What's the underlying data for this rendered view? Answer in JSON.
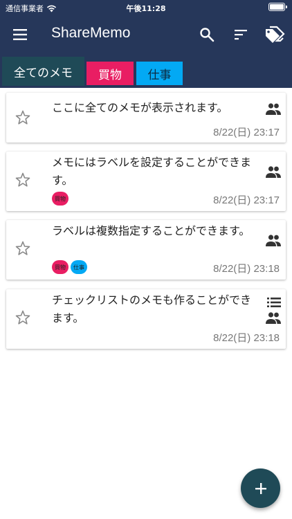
{
  "status_bar": {
    "carrier": "通信事業者",
    "time": "午後11:28"
  },
  "appbar": {
    "title": "ShareMemo",
    "icons": [
      "menu-icon",
      "search-icon",
      "sort-icon",
      "label-icon"
    ]
  },
  "tabs": [
    {
      "label": "全てのメモ",
      "color": "#1f4a57",
      "selected": true
    },
    {
      "label": "買物",
      "color": "#e91e63",
      "selected": false
    },
    {
      "label": "仕事",
      "color": "#03a9f4",
      "selected": false
    }
  ],
  "memos": [
    {
      "text": "ここに全てのメモが表示されます。",
      "labels": [],
      "date": "8/22(日) 23:17",
      "shared": true,
      "checklist": false,
      "starred": false
    },
    {
      "text": "メモにはラベルを設定することができます。",
      "labels": [
        "買物"
      ],
      "date": "8/22(日) 23:17",
      "shared": true,
      "checklist": false,
      "starred": false
    },
    {
      "text": "ラベルは複数指定することができます。",
      "labels": [
        "買物",
        "仕事"
      ],
      "date": "8/22(日) 23:18",
      "shared": true,
      "checklist": false,
      "starred": false
    },
    {
      "text": "チェックリストのメモも作ることができます。",
      "labels": [],
      "date": "8/22(日) 23:18",
      "shared": true,
      "checklist": true,
      "starred": false
    }
  ],
  "fab": {
    "label": "+",
    "icon": "add-icon"
  },
  "colors": {
    "header": "#26375a",
    "accent": "#1f4a57",
    "label_shopping": "#e91e63",
    "label_work": "#03a9f4"
  }
}
